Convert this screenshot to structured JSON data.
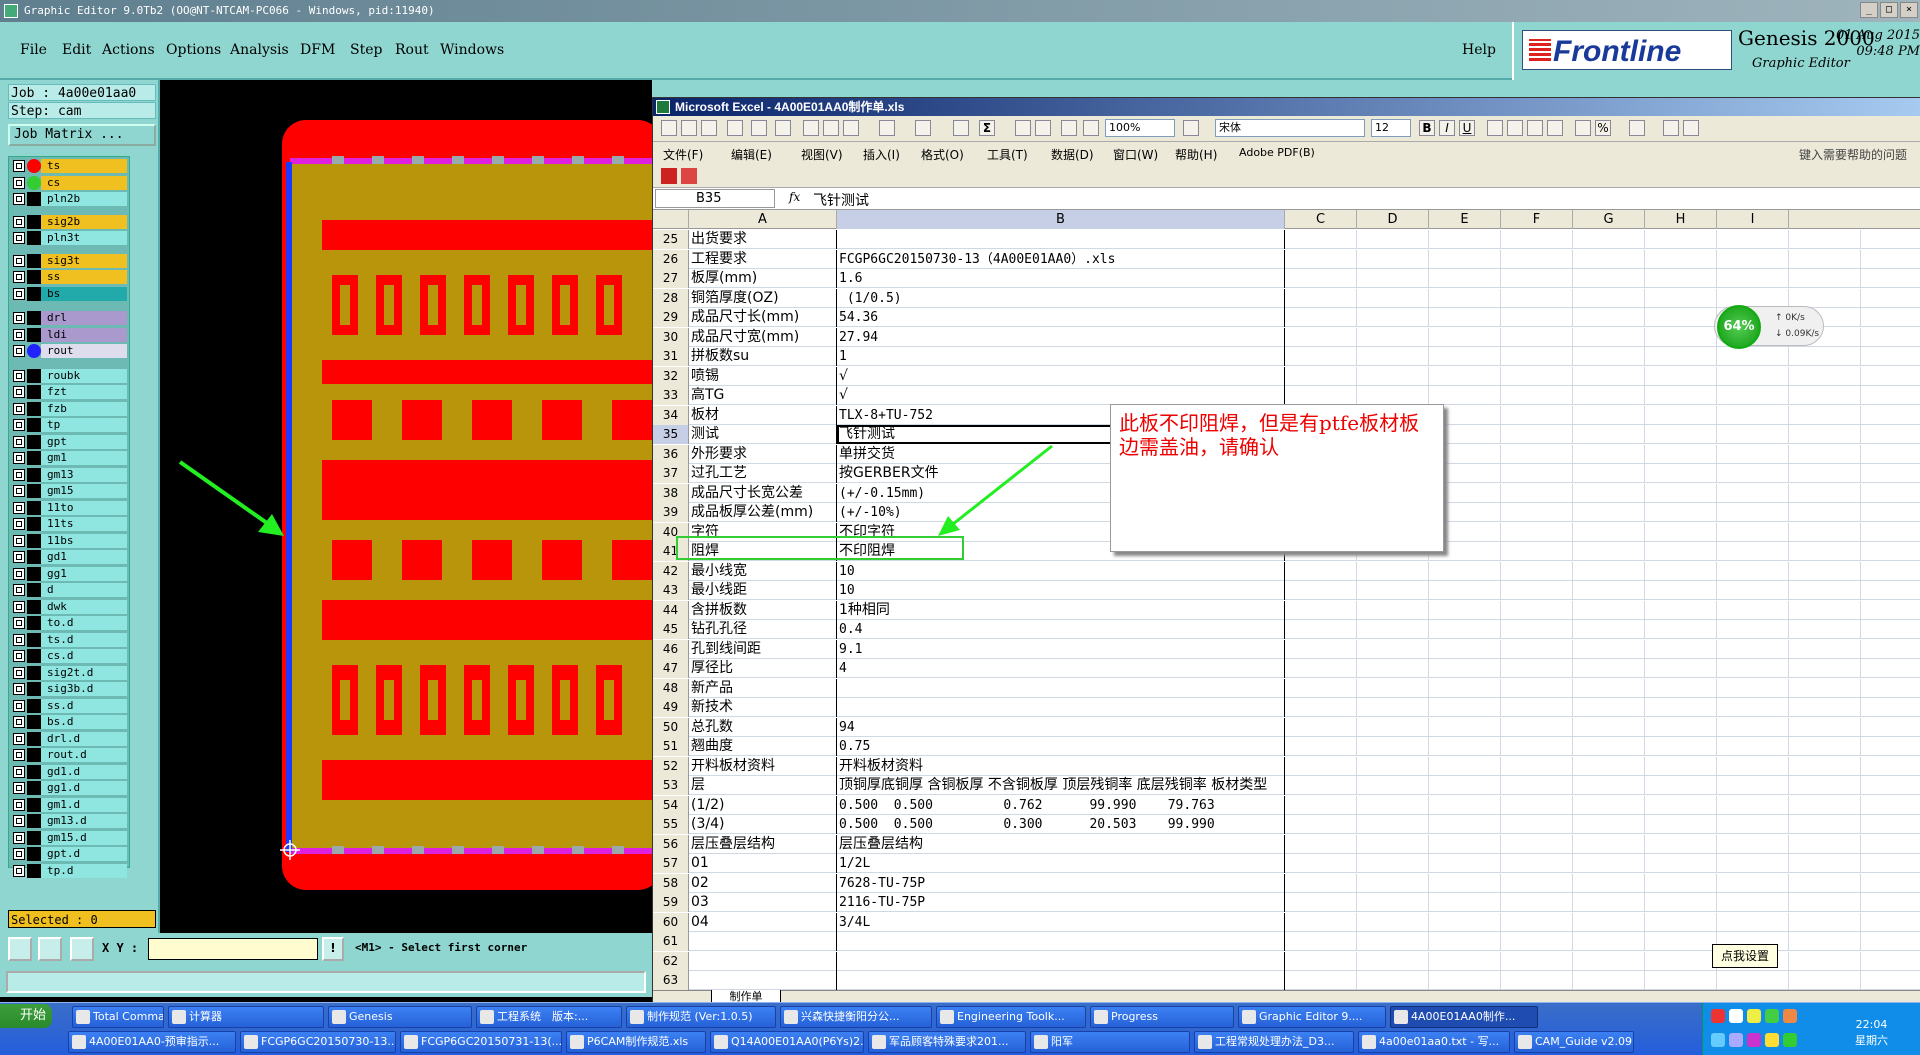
{
  "app_title": "Graphic Editor 9.0Tb2 (OO@NT-NTCAM-PC066 - Windows, pid:11940)",
  "menu": [
    "File",
    "Edit",
    "Actions",
    "Options",
    "Analysis",
    "DFM",
    "Step",
    "Rout",
    "Windows"
  ],
  "help": "Help",
  "brand": {
    "logo": "Frontline",
    "product": "Genesis 2000",
    "sub": "Graphic Editor",
    "date": "01 Aug 2015",
    "time": "09:48 PM"
  },
  "job": "Job : 4a00e01aa0",
  "step": "Step: cam",
  "job_matrix": "Job Matrix ...",
  "layers": [
    {
      "name": "ts",
      "color": "#f0c020"
    },
    {
      "name": "cs",
      "color": "#f0c020"
    },
    {
      "name": "pln2b",
      "color": "#8fe6e1"
    },
    {
      "name": "sig2b",
      "color": "#f0c020"
    },
    {
      "name": "pln3t",
      "color": "#8fe6e1"
    },
    {
      "name": "sig3t",
      "color": "#f0c020"
    },
    {
      "name": "ss",
      "color": "#f0c020"
    },
    {
      "name": "bs",
      "color": "#2aa"
    },
    {
      "name": "drl",
      "color": "#a9c"
    },
    {
      "name": "ldi",
      "color": "#a9c"
    },
    {
      "name": "rout",
      "color": "#dde"
    },
    {
      "name": "roubk",
      "color": "#8fe6e1"
    },
    {
      "name": "fzt",
      "color": "#8fe6e1"
    },
    {
      "name": "fzb",
      "color": "#8fe6e1"
    },
    {
      "name": "tp",
      "color": "#8fe6e1"
    },
    {
      "name": "gpt",
      "color": "#8fe6e1"
    },
    {
      "name": "gm1",
      "color": "#8fe6e1"
    },
    {
      "name": "gm13",
      "color": "#8fe6e1"
    },
    {
      "name": "gm15",
      "color": "#8fe6e1"
    },
    {
      "name": "11to",
      "color": "#8fe6e1"
    },
    {
      "name": "11ts",
      "color": "#8fe6e1"
    },
    {
      "name": "11bs",
      "color": "#8fe6e1"
    },
    {
      "name": "gd1",
      "color": "#8fe6e1"
    },
    {
      "name": "gg1",
      "color": "#8fe6e1"
    },
    {
      "name": "d",
      "color": "#8fe6e1"
    },
    {
      "name": "dwk",
      "color": "#8fe6e1"
    },
    {
      "name": "to.d",
      "color": "#8fe6e1"
    },
    {
      "name": "ts.d",
      "color": "#8fe6e1"
    },
    {
      "name": "cs.d",
      "color": "#8fe6e1"
    },
    {
      "name": "sig2t.d",
      "color": "#8fe6e1"
    },
    {
      "name": "sig3b.d",
      "color": "#8fe6e1"
    },
    {
      "name": "ss.d",
      "color": "#8fe6e1"
    },
    {
      "name": "bs.d",
      "color": "#8fe6e1"
    },
    {
      "name": "drl.d",
      "color": "#8fe6e1"
    },
    {
      "name": "rout.d",
      "color": "#8fe6e1"
    },
    {
      "name": "gd1.d",
      "color": "#8fe6e1"
    },
    {
      "name": "gg1.d",
      "color": "#8fe6e1"
    },
    {
      "name": "gm1.d",
      "color": "#8fe6e1"
    },
    {
      "name": "gm13.d",
      "color": "#8fe6e1"
    },
    {
      "name": "gm15.d",
      "color": "#8fe6e1"
    },
    {
      "name": "gpt.d",
      "color": "#8fe6e1"
    },
    {
      "name": "tp.d",
      "color": "#8fe6e1"
    }
  ],
  "selected": "Selected : 0",
  "xy_label": "X Y :",
  "xy_value": "",
  "prompt": "<M1> - Select first corner",
  "excel": {
    "title": "Microsoft Excel - 4A00E01AA0制作单.xls",
    "font": "宋体",
    "font_size": "12",
    "zoom": "100%",
    "menu": [
      "文件(F)",
      "编辑(E)",
      "视图(V)",
      "插入(I)",
      "格式(O)",
      "工具(T)",
      "数据(D)",
      "窗口(W)",
      "帮助(H)",
      "Adobe PDF(B)"
    ],
    "help_box": "键入需要帮助的问题",
    "namebox": "B35",
    "fx": "fx",
    "formula": "飞针测试",
    "cols": [
      "A",
      "B",
      "C",
      "D",
      "E",
      "F",
      "G",
      "H",
      "I"
    ],
    "rows": [
      {
        "n": "25",
        "a": "出货要求",
        "b": ""
      },
      {
        "n": "26",
        "a": "工程要求",
        "b": "FCGP6GC20150730-13（4A00E01AA0）.xls"
      },
      {
        "n": "27",
        "a": "板厚(mm)",
        "b": "1.6"
      },
      {
        "n": "28",
        "a": "铜箔厚度(OZ)",
        "b": " (1/0.5)"
      },
      {
        "n": "29",
        "a": "成品尺寸长(mm)",
        "b": "54.36"
      },
      {
        "n": "30",
        "a": "成品尺寸宽(mm)",
        "b": "27.94"
      },
      {
        "n": "31",
        "a": "拼板数su",
        "b": "1"
      },
      {
        "n": "32",
        "a": "喷锡",
        "b": "√"
      },
      {
        "n": "33",
        "a": "高TG",
        "b": "√"
      },
      {
        "n": "34",
        "a": "板材",
        "b": "TLX-8+TU-752"
      },
      {
        "n": "35",
        "a": "测试",
        "b": "飞针测试"
      },
      {
        "n": "36",
        "a": "外形要求",
        "b": "单拼交货"
      },
      {
        "n": "37",
        "a": "过孔工艺",
        "b": "按GERBER文件"
      },
      {
        "n": "38",
        "a": "成品尺寸长宽公差",
        "b": "(+/-0.15mm)"
      },
      {
        "n": "39",
        "a": "成品板厚公差(mm)",
        "b": "(+/-10%)"
      },
      {
        "n": "40",
        "a": "字符",
        "b": "不印字符"
      },
      {
        "n": "41",
        "a": "阻焊",
        "b": "不印阻焊"
      },
      {
        "n": "42",
        "a": "最小线宽",
        "b": "10"
      },
      {
        "n": "43",
        "a": "最小线距",
        "b": "10"
      },
      {
        "n": "44",
        "a": "含拼板数",
        "b": "1种相同"
      },
      {
        "n": "45",
        "a": "钻孔孔径",
        "b": "0.4"
      },
      {
        "n": "46",
        "a": "孔到线间距",
        "b": "9.1"
      },
      {
        "n": "47",
        "a": "厚径比",
        "b": "4"
      },
      {
        "n": "48",
        "a": "新产品",
        "b": ""
      },
      {
        "n": "49",
        "a": "新技术",
        "b": ""
      },
      {
        "n": "50",
        "a": "总孔数",
        "b": "94"
      },
      {
        "n": "51",
        "a": "翘曲度",
        "b": "0.75"
      },
      {
        "n": "52",
        "a": "开料板材资料",
        "b": "开料板材资料"
      },
      {
        "n": "53",
        "a": "层",
        "b": "顶铜厚底铜厚 含铜板厚 不含铜板厚 顶层残铜率 底层残铜率 板材类型"
      },
      {
        "n": "54",
        "a": "(1/2)",
        "b": "0.500  0.500         0.762      99.990    79.763"
      },
      {
        "n": "55",
        "a": "(3/4)",
        "b": "0.500  0.500         0.300      20.503    99.990"
      },
      {
        "n": "56",
        "a": "层压叠层结构",
        "b": "层压叠层结构"
      },
      {
        "n": "57",
        "a": "01",
        "b": "1/2L"
      },
      {
        "n": "58",
        "a": "02",
        "b": "7628-TU-75P"
      },
      {
        "n": "59",
        "a": "03",
        "b": "2116-TU-75P"
      },
      {
        "n": "60",
        "a": "04",
        "b": "3/4L"
      },
      {
        "n": "61",
        "a": "",
        "b": ""
      },
      {
        "n": "62",
        "a": "",
        "b": ""
      },
      {
        "n": "63",
        "a": "",
        "b": ""
      }
    ],
    "sheet_tab": "制作单"
  },
  "callout": "此板不印阻焊，但是有ptfe板材板边需盖油，请确认",
  "speed": {
    "pct": "64%",
    "up": "0K/s",
    "down": "0.09K/s"
  },
  "tooltip": "点我设置",
  "taskbar": {
    "start": "开始",
    "row1": [
      "Total Commander 7...",
      "计算器",
      "Genesis",
      "工程系统　版本:...",
      "制作规范 (Ver:1.0.5)",
      "兴森快捷衡阳分公...",
      "Engineering Toolk...",
      "Progress",
      "Graphic Editor 9....",
      "4A00E01AA0制作..."
    ],
    "row2": [
      "4A00E01AA0-预审指示...",
      "FCGP6GC20150730-13...",
      "FCGP6GC20150731-13(...",
      "P6CAM制作规范.xls",
      "Q14A00E01AA0(P6Ys)2...",
      "军品顾客特殊要求201...",
      "阳军",
      "工程常规处理办法_D3...",
      "4a00e01aa0.txt - 写...",
      "CAM_Guide v2.09"
    ],
    "time": "22:04",
    "day": "星期六"
  }
}
